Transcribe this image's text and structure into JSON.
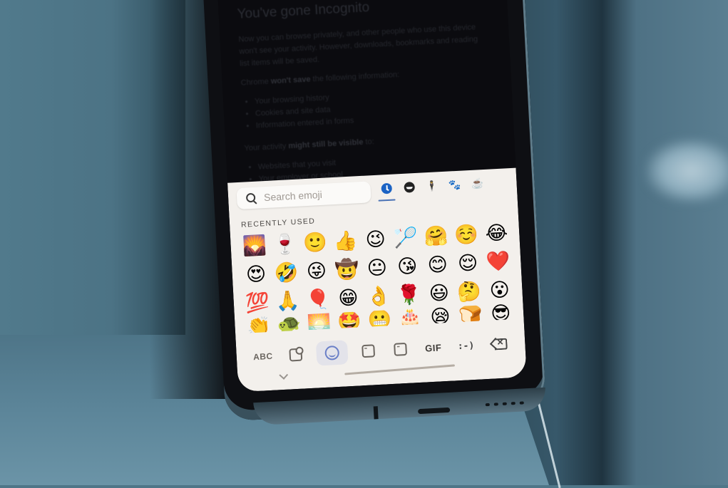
{
  "incognito_page": {
    "title": "You've gone Incognito",
    "intro": "Now you can browse privately, and other people who use this device won't see your activity. However, downloads, bookmarks and reading list items will be saved.",
    "wont_save_prefix": "Chrome ",
    "wont_save_bold": "won't save",
    "wont_save_suffix": " the following information:",
    "wont_save_items": [
      "Your browsing history",
      "Cookies and site data",
      "Information entered in forms"
    ],
    "visible_prefix": "Your activity ",
    "visible_bold": "might still be visible",
    "visible_suffix": " to:",
    "visible_items": [
      "Websites that you visit",
      "Your employer or school"
    ]
  },
  "keyboard": {
    "search": {
      "placeholder": "Search emoji",
      "value": ""
    },
    "category_tabs": [
      {
        "name": "recent",
        "icon": "clock-icon",
        "active": true
      },
      {
        "name": "smileys",
        "icon": "smiley-icon",
        "glyph": "☻"
      },
      {
        "name": "people",
        "icon": "person-icon",
        "glyph": "🕴"
      },
      {
        "name": "animals",
        "icon": "animal-icon",
        "glyph": "🐾"
      },
      {
        "name": "food",
        "icon": "cup-icon",
        "glyph": "☕"
      }
    ],
    "section_label": "RECENTLY USED",
    "emoji_rows": [
      [
        "🌄",
        "🍷",
        "🙂",
        "👍",
        "😉",
        "🏸",
        "🤗",
        "☺️",
        "😂"
      ],
      [
        "😍",
        "🤣",
        "😜",
        "🤠",
        "😐",
        "😘",
        "😊",
        "😌",
        "❤️"
      ],
      [
        "💯",
        "🙏",
        "🎈",
        "😁",
        "👌",
        "🌹",
        "😃",
        "🤔",
        "😮"
      ],
      [
        "👏",
        "🐢",
        "🌅",
        "🤩",
        "😬",
        "🎂",
        "😪",
        "🍞",
        "😎"
      ]
    ],
    "bottom_bar": {
      "abc_label": "ABC",
      "sticker_search_icon": "sticker-search-icon",
      "emoji_icon": "emoji-icon",
      "bitmoji_icon": "bitmoji-icon",
      "sticker_icon": "sticker-icon",
      "gif_label": "GIF",
      "emoticon_label": ":-)",
      "backspace_icon": "backspace-icon"
    },
    "active_bottom_tab": "emoji"
  },
  "colors": {
    "keyboard_bg": "#f3f0ec",
    "accent_blue": "#1b63c4",
    "tab_underline": "#4a72b5",
    "screen_bg": "#0b0b0f",
    "background_teal": "#4f7688"
  }
}
